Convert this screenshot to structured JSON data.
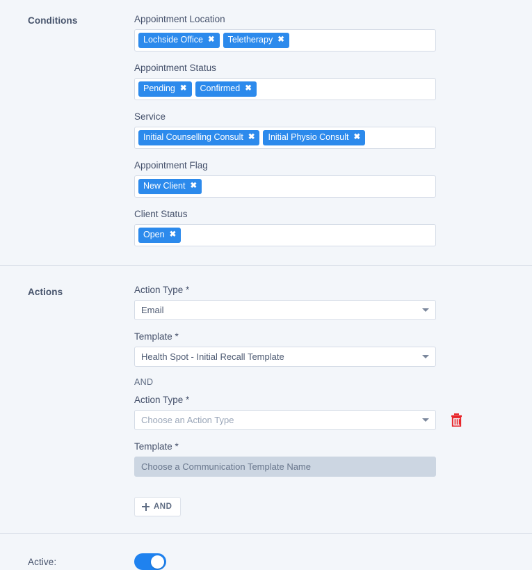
{
  "conditions": {
    "section_label": "Conditions",
    "fields": [
      {
        "label": "Appointment Location",
        "chips": [
          "Lochside Office",
          "Teletherapy"
        ]
      },
      {
        "label": "Appointment Status",
        "chips": [
          "Pending",
          "Confirmed"
        ]
      },
      {
        "label": "Service",
        "chips": [
          "Initial Counselling Consult",
          "Initial Physio Consult"
        ]
      },
      {
        "label": "Appointment Flag",
        "chips": [
          "New Client"
        ]
      },
      {
        "label": "Client Status",
        "chips": [
          "Open"
        ]
      }
    ],
    "chip_remove_glyph": "✖"
  },
  "actions": {
    "section_label": "Actions",
    "action_type_label_1": "Action Type *",
    "action_type_value_1": "Email",
    "template_label_1": "Template *",
    "template_value_1": "Health Spot - Initial Recall Template",
    "conjunction": "AND",
    "action_type_label_2": "Action Type *",
    "action_type_placeholder_2": "Choose an Action Type",
    "template_label_2": "Template *",
    "template_placeholder_2": "Choose a Communication Template Name",
    "delete_icon": "trash-icon",
    "add_button_label": "AND",
    "add_button_icon": "plus-icon"
  },
  "active": {
    "label": "Active:",
    "toggle_state": "on"
  },
  "colors": {
    "page_background": "#f3f6fa",
    "chip_blue": "#2c8aec",
    "toggle_blue": "#1f82ef",
    "delete_red": "#e8252a",
    "field_border": "#d4dbe6",
    "disabled_field": "#ccd6e2",
    "divider": "#dfe4ec"
  }
}
